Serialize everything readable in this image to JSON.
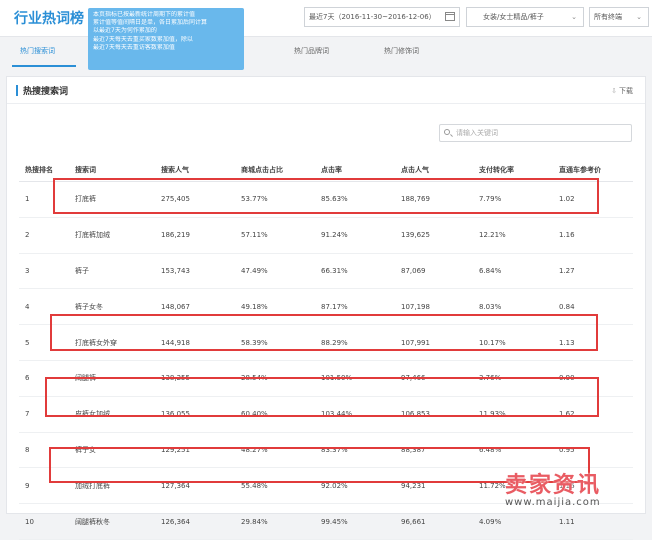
{
  "header": {
    "title": "行业热词榜",
    "date_range": "最近7天（2016-11-30~2016-12-06）",
    "category": "女装/女士精品/裤子",
    "terminal": "所有终端"
  },
  "tooltip": {
    "lines": [
      "本页指标已按最新统计周期下的累计值",
      "累计值等值间隔日是单，各日累加后同计算",
      "以最近7天为何作累加的",
      "最近7天每天去重买家数累加值，除以",
      "最近7天每天去重访客数累加值"
    ]
  },
  "tabs": [
    "热门搜索词",
    "",
    "热门品牌词",
    "热门修饰词"
  ],
  "panel": {
    "title": "热搜搜索词",
    "download": "下载",
    "search_placeholder": "请输入关键词"
  },
  "table": {
    "columns": [
      "热搜排名",
      "搜索词",
      "搜索人气",
      "商城点击占比",
      "点击率",
      "点击人气",
      "支付转化率",
      "直通车参考价"
    ],
    "rows": [
      [
        "1",
        "打底裤",
        "275,405",
        "53.77%",
        "85.63%",
        "188,769",
        "7.79%",
        "1.02"
      ],
      [
        "2",
        "打底裤加绒",
        "186,219",
        "57.11%",
        "91.24%",
        "139,625",
        "12.21%",
        "1.16"
      ],
      [
        "3",
        "裤子",
        "153,743",
        "47.49%",
        "66.31%",
        "87,069",
        "6.84%",
        "1.27"
      ],
      [
        "4",
        "裤子女冬",
        "148,067",
        "49.18%",
        "87.17%",
        "107,198",
        "8.03%",
        "0.84"
      ],
      [
        "5",
        "打底裤女外穿",
        "144,918",
        "58.39%",
        "88.29%",
        "107,991",
        "10.17%",
        "1.13"
      ],
      [
        "6",
        "阔腿裤",
        "138,255",
        "28.54%",
        "101.50%",
        "97,466",
        "3.76%",
        "0.90"
      ],
      [
        "7",
        "皮裤女加绒",
        "136,055",
        "60.40%",
        "103.44%",
        "106,853",
        "11.93%",
        "1.62"
      ],
      [
        "8",
        "裤子女",
        "129,251",
        "48.27%",
        "83.37%",
        "88,387",
        "6.48%",
        "0.95"
      ],
      [
        "9",
        "加绒打底裤",
        "127,364",
        "55.48%",
        "92.02%",
        "94,231",
        "11.72%",
        "1.16"
      ],
      [
        "10",
        "阔腿裤秋冬",
        "126,364",
        "29.84%",
        "99.45%",
        "96,661",
        "4.09%",
        "1.11"
      ]
    ]
  },
  "watermark": {
    "cn": "卖家资讯",
    "url": "www.maijia.com"
  },
  "colors": {
    "accent": "#2b8fd6",
    "highlight": "#e13b3b",
    "tooltip": "#69b8ec"
  }
}
